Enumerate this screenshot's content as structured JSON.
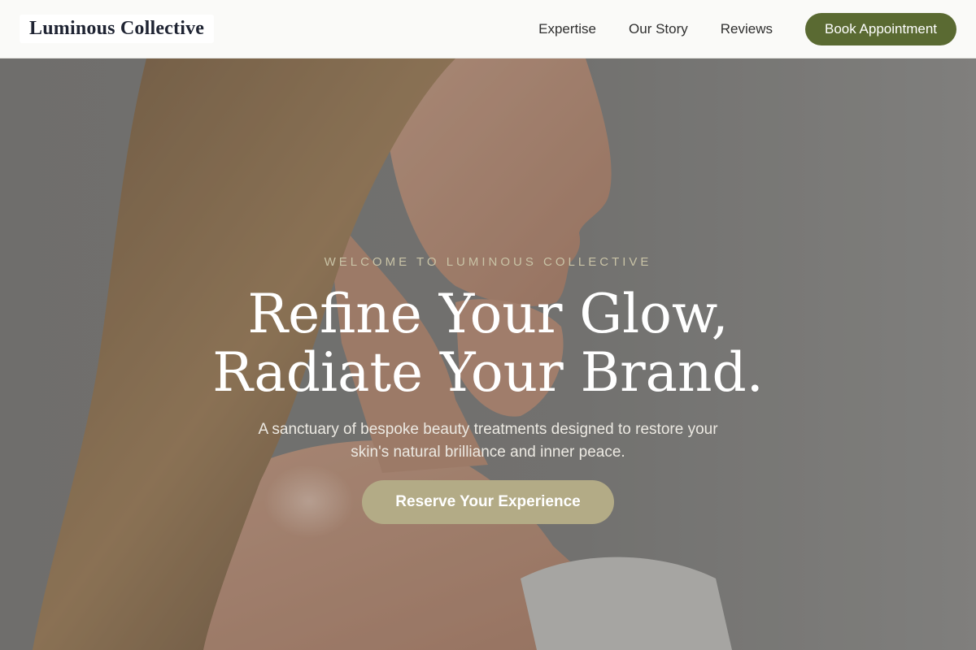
{
  "brand": {
    "name": "Luminous Collective"
  },
  "nav": {
    "links": [
      "Expertise",
      "Our Story",
      "Reviews"
    ],
    "cta_label": "Book Appointment"
  },
  "hero": {
    "eyebrow": "WELCOME TO LUMINOUS COLLECTIVE",
    "headline_line1": "Refine Your Glow,",
    "headline_line2": "Radiate Your Brand.",
    "subtitle": "A sanctuary of bespoke beauty treatments designed to restore your skin's natural brilliance and inner peace.",
    "cta_label": "Reserve Your Experience"
  },
  "colors": {
    "brand_green": "#5a6a32",
    "accent_sand": "#b3ab86",
    "nav_background": "#fafaf8"
  }
}
